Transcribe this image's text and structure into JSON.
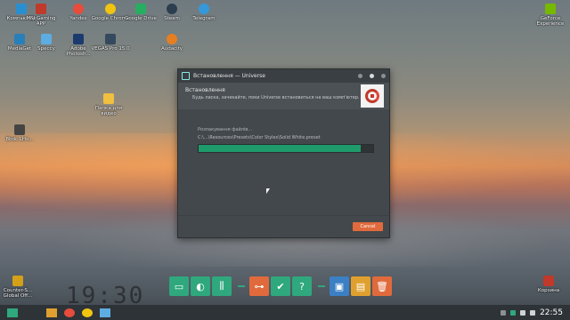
{
  "desktop": {
    "icons": [
      {
        "label": "Компьютер",
        "icon": "computer-icon",
        "color": "#2a8fd0"
      },
      {
        "label": "MSI Gaming APP",
        "icon": "msi-icon",
        "color": "#c0392b"
      },
      {
        "label": "Yandex",
        "icon": "yandex-icon",
        "color": "#e74c3c"
      },
      {
        "label": "Google Chrome",
        "icon": "chrome-icon",
        "color": "#f1c40f"
      },
      {
        "label": "Google Drive",
        "icon": "drive-icon",
        "color": "#27ae60"
      },
      {
        "label": "Steam",
        "icon": "steam-icon",
        "color": "#2c3e50"
      },
      {
        "label": "Telegram",
        "icon": "telegram-icon",
        "color": "#3498db"
      },
      {
        "label": "MediaGet",
        "icon": "mediaget-icon",
        "color": "#2980b9"
      },
      {
        "label": "Speccy",
        "icon": "speccy-icon",
        "color": "#5dade2"
      },
      {
        "label": "Adobe Photosh...",
        "icon": "photoshop-icon",
        "color": "#1b3b6f"
      },
      {
        "label": "VEGAS Pro 15.0",
        "icon": "vegas-icon",
        "color": "#34495e"
      },
      {
        "label": "Audacity",
        "icon": "audacity-icon",
        "color": "#e67e22"
      },
      {
        "label": "Папка для видео",
        "icon": "folder-icon",
        "color": "#f0c040"
      },
      {
        "label": "8bdc LHo...",
        "icon": "file-icon",
        "color": "#444444"
      },
      {
        "label": "GeForce Experience",
        "icon": "geforce-icon",
        "color": "#76b900"
      },
      {
        "label": "Counter-S... Global Off...",
        "icon": "csgo-icon",
        "color": "#d4a017"
      },
      {
        "label": "Корзина",
        "icon": "recycle-bin-icon",
        "color": "#c0392b"
      }
    ]
  },
  "window": {
    "title": "Встановлення — Universe",
    "header_title": "Встановлення",
    "header_subtitle": "Будь ласка, зачекайте, поки Universe встановиться на ваш комп'ютер.",
    "status": "Розпакування файлів...",
    "path": "C:\\...\\Resources\\Presets\\Color Styles\\Solid White.preset",
    "progress": 0.93,
    "cancel_label": "Cancel"
  },
  "dock": {
    "items": [
      {
        "icon": "monitor-icon",
        "color": "#2fa87d",
        "glyph": "▭"
      },
      {
        "icon": "globe-icon",
        "color": "#2fa87d",
        "glyph": "◐"
      },
      {
        "icon": "sliders-icon",
        "color": "#2fa87d",
        "glyph": "⫼"
      },
      {
        "icon": "gamepad-icon",
        "color": "#e06a3c",
        "glyph": "⊶"
      },
      {
        "icon": "check-icon",
        "color": "#2fa87d",
        "glyph": "✔"
      },
      {
        "icon": "help-icon",
        "color": "#2fa87d",
        "glyph": "?"
      },
      {
        "icon": "window-icon",
        "color": "#3b7fc4",
        "glyph": "▣"
      },
      {
        "icon": "folder-icon",
        "color": "#e0a030",
        "glyph": "▤"
      },
      {
        "icon": "trash-icon",
        "color": "#e06a3c",
        "glyph": "🗑"
      }
    ]
  },
  "background_clock": "19:30",
  "taskbar": {
    "clock": "22:55",
    "apps": [
      {
        "icon": "start-icon",
        "color": "#2fa87d"
      },
      {
        "icon": "folder-icon",
        "color": "#e0a030"
      },
      {
        "icon": "yandex-icon",
        "color": "#e74c3c"
      },
      {
        "icon": "chrome-icon",
        "color": "#f1c40f"
      },
      {
        "icon": "installer-icon",
        "color": "#5dade2"
      }
    ]
  }
}
